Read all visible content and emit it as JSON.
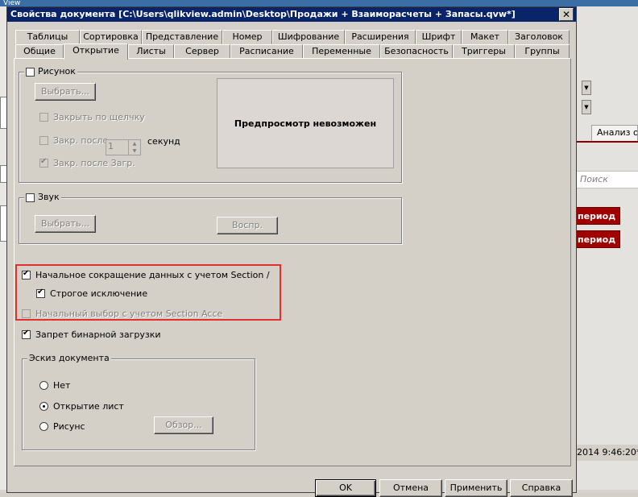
{
  "background": {
    "window_title_fragment": "View",
    "tab_label": "Анализ о",
    "search_placeholder": "Поиск",
    "period_button_1": "период",
    "period_button_2": "период",
    "status_time": "2014 9:46:20*"
  },
  "dialog": {
    "title": "Свойства документа [C:\\Users\\qlikview.admin\\Desktop\\Продажи + Взаиморасчеты + Запасы.qvw*]",
    "close_glyph": "✕",
    "tabs_row1": [
      "Таблицы",
      "Сортировка",
      "Представление",
      "Номер",
      "Шифрование",
      "Расширения",
      "Шрифт",
      "Макет",
      "Заголовок"
    ],
    "tabs_row2": [
      "Общие",
      "Открытие",
      "Листы",
      "Сервер",
      "Расписание",
      "Переменные",
      "Безопасность",
      "Триггеры",
      "Группы"
    ],
    "active_tab": "Открытие"
  },
  "picture_group": {
    "label": "Рисунок",
    "checked": false,
    "select_button": "Выбрать...",
    "close_on_click": "Закрыть по щелчку",
    "close_after": "Закр. после",
    "close_after_value": "1",
    "seconds": "секунд",
    "close_after_load": "Закр. после Загр.",
    "preview_text": "Предпросмотр невозможен"
  },
  "sound_group": {
    "label": "Звук",
    "checked": false,
    "select_button": "Выбрать...",
    "play_button": "Воспр."
  },
  "section_access": {
    "initial_reduction": "Начальное сокращение данных с учетом Section /",
    "initial_reduction_checked": true,
    "strict_exclusion": "Строгое исключение",
    "strict_exclusion_checked": true,
    "initial_selection": "Начальный выбор с учетом Section Acce",
    "initial_selection_checked": false
  },
  "binary_load": {
    "label": "Запрет бинарной загрузки",
    "checked": true
  },
  "thumbnail_group": {
    "label": "Эскиз документа",
    "options": [
      "Нет",
      "Открытие лист",
      "Рисунс"
    ],
    "selected": "Открытие лист",
    "browse_button": "Обзор..."
  },
  "footer": {
    "ok": "OK",
    "cancel": "Отмена",
    "apply": "Применить",
    "help": "Справка"
  }
}
